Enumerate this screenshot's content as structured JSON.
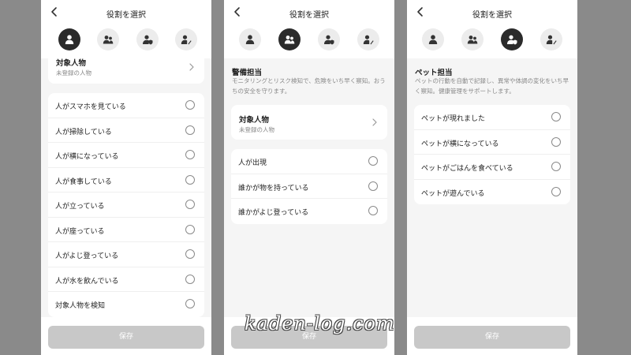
{
  "colors": {
    "background": "#8a8a8a",
    "selected_role": "#2b2b2b",
    "unselected_role": "#ececec",
    "save_disabled": "#c8c8c8"
  },
  "icons": {
    "back": "chevron-left-icon",
    "chevron": "chevron-right-icon",
    "roles": [
      "person-icon",
      "people-icon",
      "shield-person-icon",
      "pet-person-icon"
    ]
  },
  "screens": [
    {
      "title": "役割を選択",
      "target": {
        "title": "対象人物",
        "subtitle": "未登録の人物"
      },
      "options": [
        "人がスマホを見ている",
        "人が掃除している",
        "人が横になっている",
        "人が食事している",
        "人が立っている",
        "人が座っている",
        "人がよじ登っている",
        "人が水を飲んでいる",
        "対象人物を検知"
      ],
      "save_label": "保存"
    },
    {
      "title": "役割を選択",
      "role_heading": "警備担当",
      "role_description": "モニタリングとリスク検知で、危険をいち早く察知。おうちの安全を守ります。",
      "target": {
        "title": "対象人物",
        "subtitle": "未登録の人物"
      },
      "options": [
        "人が出現",
        "誰かが物を持っている",
        "誰かがよじ登っている"
      ],
      "save_label": "保存"
    },
    {
      "title": "役割を選択",
      "role_heading": "ペット担当",
      "role_description": "ペットの行動を自動で記録し、異常や体調の変化をいち早く察知。健康管理をサポートします。",
      "options": [
        "ペットが現れました",
        "ペットが横になっている",
        "ペットがごはんを食べている",
        "ペットが遊んでいる"
      ],
      "save_label": "保存"
    }
  ],
  "watermark": "kaden-log.com"
}
